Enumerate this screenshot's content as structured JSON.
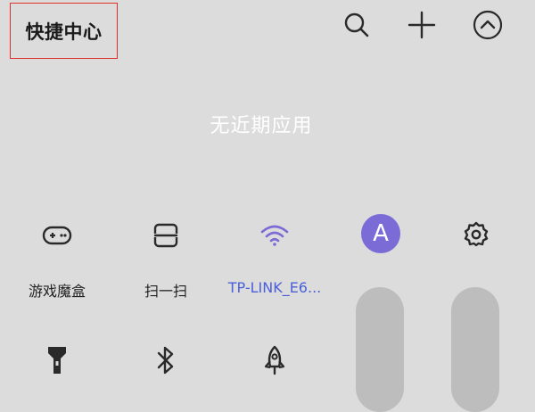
{
  "header": {
    "title": "快捷中心",
    "actions": [
      {
        "name": "search",
        "icon": "search-icon"
      },
      {
        "name": "add",
        "icon": "plus-icon"
      },
      {
        "name": "collapse",
        "icon": "chevron-up-circle-icon"
      }
    ]
  },
  "recent_apps": {
    "empty_text": "无近期应用"
  },
  "tiles": [
    {
      "label": "游戏魔盒",
      "icon": "gamepad-icon"
    },
    {
      "label": "扫一扫",
      "icon": "scan-icon"
    },
    {
      "label": "TP-LINK_E6...",
      "icon": "wifi-icon"
    },
    {
      "label": "",
      "icon": "account-icon",
      "avatar_letter": "A"
    },
    {
      "label": "",
      "icon": "gear-icon"
    },
    {
      "label": "",
      "icon": "flashlight-icon"
    },
    {
      "label": "",
      "icon": "bluetooth-icon"
    },
    {
      "label": "",
      "icon": "rocket-icon"
    }
  ],
  "sliders": [
    {
      "name": "brightness"
    },
    {
      "name": "volume"
    }
  ],
  "colors": {
    "background": "#dcdcdc",
    "accent": "#7b6bd6",
    "wifi_label": "#4a5fd8",
    "highlight_border": "#e0312b",
    "slider": "#bdbdbd"
  }
}
